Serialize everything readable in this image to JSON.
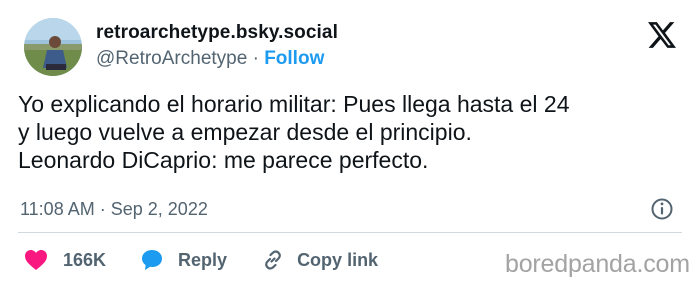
{
  "author": {
    "display_name": "retroarchetype.bsky.social",
    "handle": "@RetroArchetype",
    "separator": "·",
    "follow_label": "Follow"
  },
  "tweet": {
    "lines": [
      "Yo explicando el horario militar: Pues llega hasta el 24",
      "y luego vuelve a empezar desde el principio.",
      "Leonardo DiCaprio: me parece perfecto."
    ],
    "time": "11:08 AM",
    "separator": "·",
    "date": "Sep 2, 2022"
  },
  "actions": {
    "like_count": "166K",
    "reply_label": "Reply",
    "copy_link_label": "Copy link"
  },
  "watermark": "boredpanda.com",
  "icons": {
    "logo": "x-logo-icon",
    "info": "info-icon",
    "like": "heart-icon",
    "reply": "speech-bubble-icon",
    "copy": "link-icon"
  },
  "colors": {
    "text": "#0f1419",
    "secondary": "#536471",
    "follow": "#1d9bf0",
    "heart": "#f91880",
    "reply_bubble": "#1d9bf0",
    "watermark": "#a3a3a3"
  }
}
